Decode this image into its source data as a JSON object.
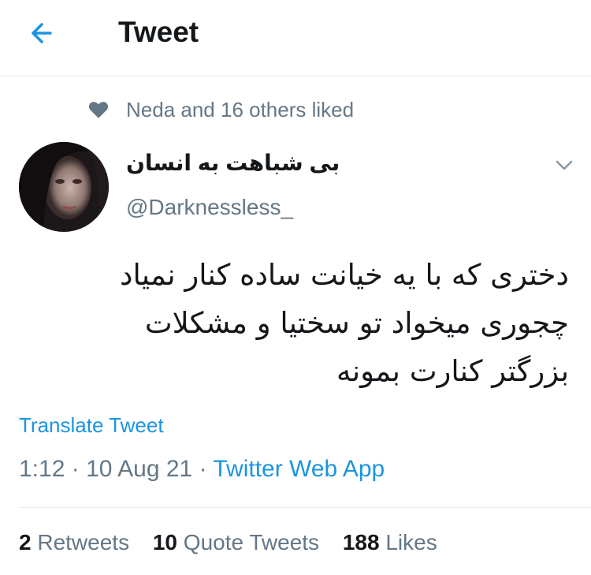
{
  "header": {
    "title": "Tweet"
  },
  "social_context": {
    "text": "Neda and 16 others liked"
  },
  "user": {
    "display_name": "بی شباهت به انسان",
    "handle": "@Darknessless_"
  },
  "tweet": {
    "lines": [
      "دختری که با یه خیانت ساده کنار نمیاد",
      "چجوری میخواد تو سختیا و مشکلات",
      "بزرگتر کنارت بمونه"
    ]
  },
  "translate_label": "Translate Tweet",
  "meta": {
    "time": "1:12",
    "separator": "·",
    "date": "10 Aug 21",
    "app": "Twitter Web App"
  },
  "stats": {
    "retweets": {
      "count": "2",
      "label": "Retweets"
    },
    "quote_tweets": {
      "count": "10",
      "label": "Quote Tweets"
    },
    "likes": {
      "count": "188",
      "label": "Likes"
    }
  },
  "colors": {
    "accent": "#1b95e0",
    "muted": "#657786",
    "text": "#14171a",
    "divider": "#e6ecf0"
  }
}
